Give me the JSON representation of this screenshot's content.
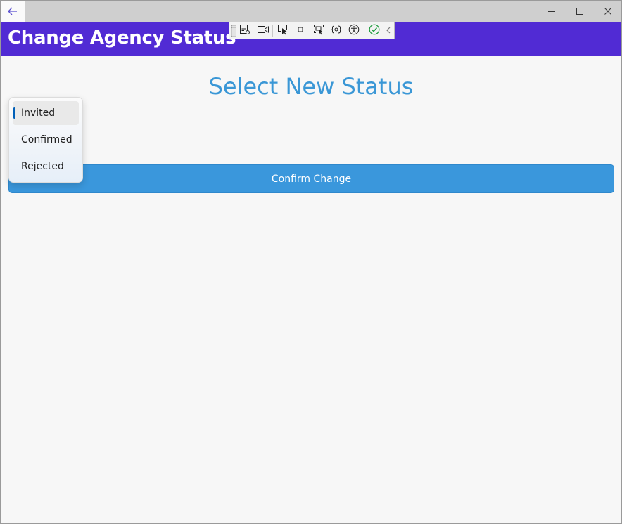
{
  "window": {
    "back_icon": "back-arrow-icon",
    "controls": [
      "minimize-icon",
      "maximize-icon",
      "close-icon"
    ]
  },
  "header": {
    "title": "Change Agency Status",
    "background": "#512bd4"
  },
  "debug_toolbar": {
    "icons": [
      "live-visual-tree-icon",
      "record-icon",
      "select-element-icon",
      "display-layout-adorners-icon",
      "track-focus-icon",
      "binding-failures-icon",
      "accessibility-icon",
      "checkmark-icon",
      "collapse-chevron-icon"
    ]
  },
  "main": {
    "heading": "Select New Status",
    "confirm_button": "Confirm Change",
    "accent": "#3a97dc"
  },
  "status_dropdown": {
    "selected": "Invited",
    "options": [
      "Invited",
      "Confirmed",
      "Rejected"
    ]
  }
}
